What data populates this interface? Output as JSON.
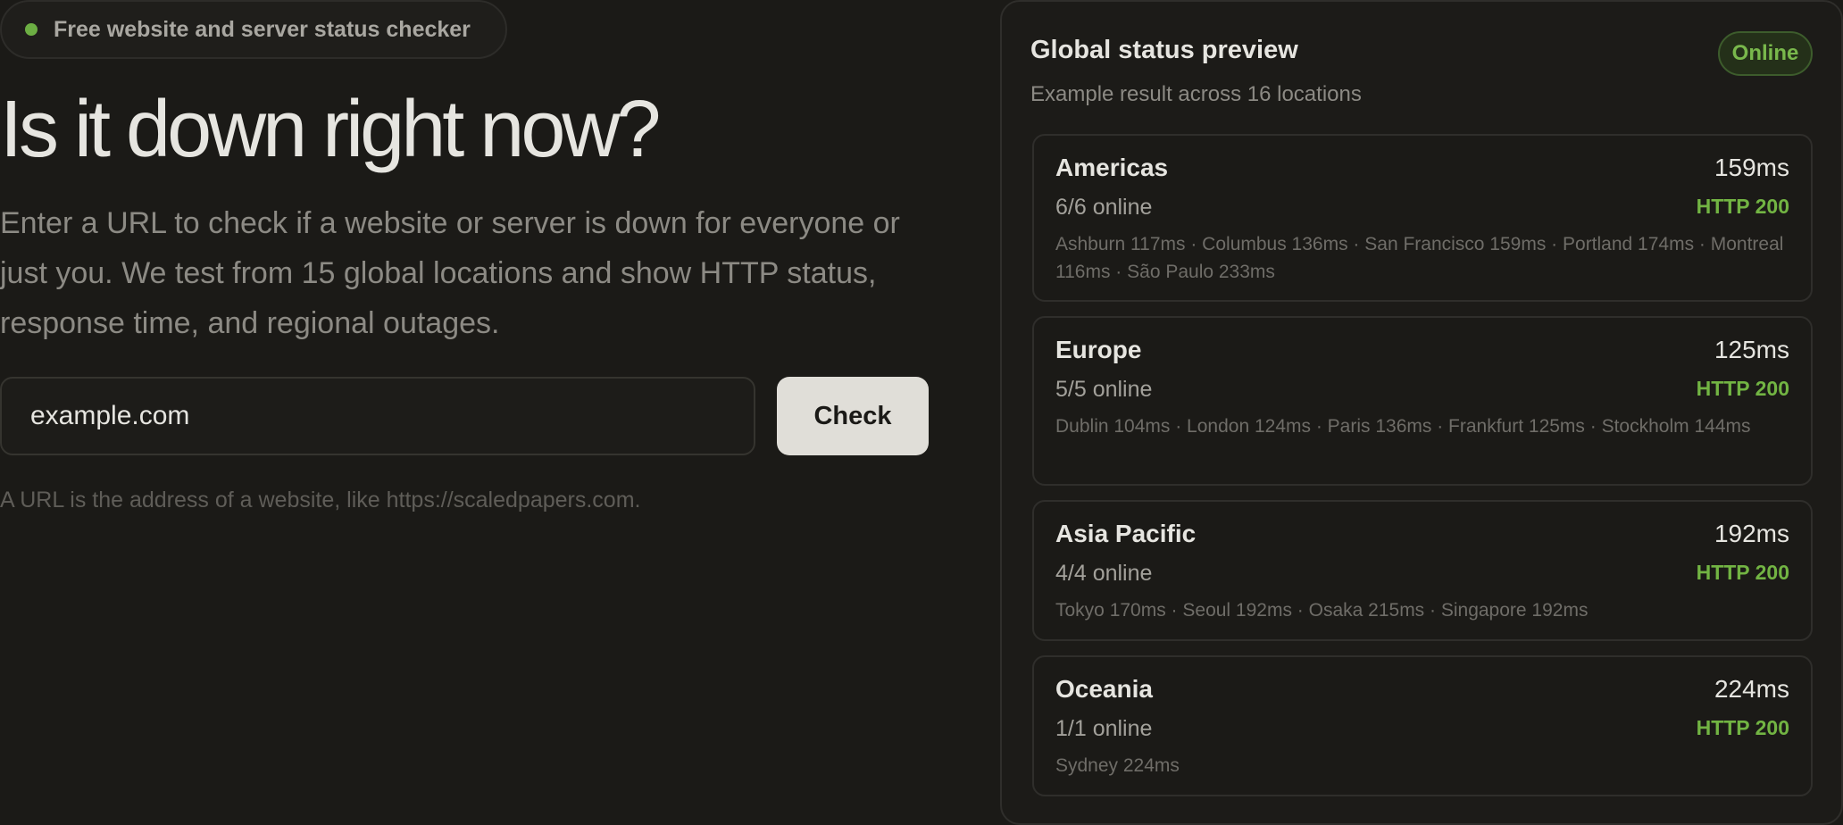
{
  "hero": {
    "badge_text": "Free website and server status checker",
    "title": "Is it down right now?",
    "description": "Enter a URL to check if a website or server is down for everyone or just you. We test from 15 global locations and show HTTP status, response time, and regional outages.",
    "input_value": "example.com",
    "check_label": "Check",
    "hint": "A URL is the address of a website, like https://scaledpapers.com."
  },
  "panel": {
    "title": "Global status preview",
    "subtitle": "Example result across 16 locations",
    "status_badge": "Online",
    "regions": [
      {
        "name": "Americas",
        "ms": "159ms",
        "count": "6/6 online",
        "http": "HTTP 200",
        "locations": "Ashburn 117ms · Columbus 136ms · San Francisco 159ms · Portland 174ms · Montreal 116ms · São Paulo 233ms"
      },
      {
        "name": "Europe",
        "ms": "125ms",
        "count": "5/5 online",
        "http": "HTTP 200",
        "locations": "Dublin 104ms · London 124ms · Paris 136ms · Frankfurt 125ms · Stockholm 144ms"
      },
      {
        "name": "Asia Pacific",
        "ms": "192ms",
        "count": "4/4 online",
        "http": "HTTP 200",
        "locations": "Tokyo 170ms · Seoul 192ms · Osaka 215ms · Singapore 192ms"
      },
      {
        "name": "Oceania",
        "ms": "224ms",
        "count": "1/1 online",
        "http": "HTTP 200",
        "locations": "Sydney 224ms"
      }
    ]
  },
  "colors": {
    "background": "#1b1a17",
    "accent_green": "#72b443",
    "button_bg": "#e0ded8"
  }
}
